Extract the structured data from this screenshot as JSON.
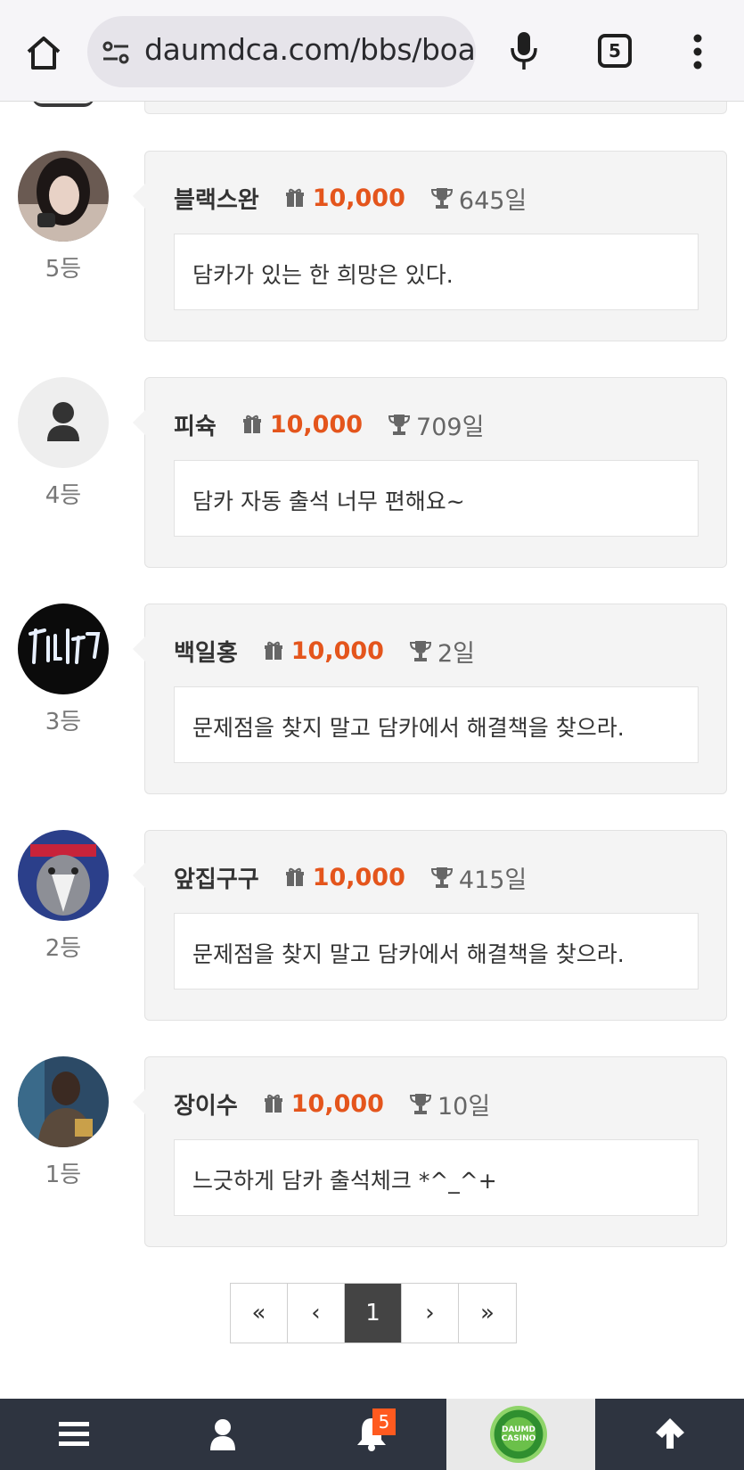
{
  "browser": {
    "url": "daumdca.com/bbs/boar",
    "tab_count": "5"
  },
  "comments": [
    {
      "nickname": "블랙스완",
      "points": "10,000",
      "days": "645일",
      "message": "담카가 있는 한 희망은 있다.",
      "rank": "5등",
      "avatar": "photo"
    },
    {
      "nickname": "피슉",
      "points": "10,000",
      "days": "709일",
      "message": "담카 자동 출석 너무 편해요~",
      "rank": "4등",
      "avatar": "default-person-icon"
    },
    {
      "nickname": "백일홍",
      "points": "10,000",
      "days": "2일",
      "message": "문제점을 찾지 말고 담카에서 해결책을 찾으라.",
      "rank": "3등",
      "avatar": "photo"
    },
    {
      "nickname": "앞집구구",
      "points": "10,000",
      "days": "415일",
      "message": "문제점을 찾지 말고 담카에서 해결책을 찾으라.",
      "rank": "2등",
      "avatar": "photo"
    },
    {
      "nickname": "장이수",
      "points": "10,000",
      "days": "10일",
      "message": "느긋하게 담카 출석체크 *^_^+",
      "rank": "1등",
      "avatar": "photo"
    }
  ],
  "pagination": {
    "first": "«",
    "prev": "‹",
    "current": "1",
    "next": "›",
    "last": "»"
  },
  "bottom_nav": {
    "notification_count": "5",
    "logo_text": "DAUMD CASINO",
    "icons": [
      "menu-icon",
      "user-icon",
      "bell-icon",
      "casino-logo",
      "arrow-up-icon"
    ]
  },
  "colors": {
    "points": "#e4551c",
    "bottom_bar": "#2e3440",
    "badge": "#ff5a1f"
  }
}
